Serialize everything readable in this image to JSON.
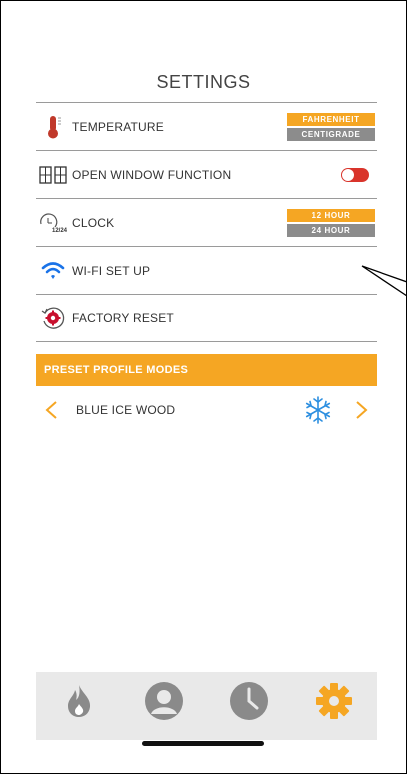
{
  "title": "SETTINGS",
  "settings": {
    "temperature": {
      "label": "TEMPERATURE",
      "options": [
        "FAHRENHEIT",
        "CENTIGRADE"
      ],
      "selected": "FAHRENHEIT"
    },
    "open_window": {
      "label": "OPEN WINDOW FUNCTION",
      "enabled": true
    },
    "clock": {
      "label": "CLOCK",
      "icon_text": "12/24",
      "options": [
        "12 HOUR",
        "24 HOUR"
      ],
      "selected": "12 HOUR"
    },
    "wifi": {
      "label": "WI-FI SET UP"
    },
    "factory_reset": {
      "label": "FACTORY RESET"
    }
  },
  "preset": {
    "header": "PRESET PROFILE MODES",
    "current": "BLUE ICE WOOD",
    "icon": "snowflake-icon"
  },
  "tabbar": {
    "tabs": [
      {
        "icon": "flame-icon",
        "active": false
      },
      {
        "icon": "profile-icon",
        "active": false
      },
      {
        "icon": "clock-icon",
        "active": false
      },
      {
        "icon": "settings-gear-icon",
        "active": true
      }
    ]
  },
  "colors": {
    "accent": "#f5a623",
    "inactive": "#8c8c8c",
    "toggle_on": "#d9342b",
    "wifi": "#1a73e8",
    "snowflake": "#2d8fe0",
    "thermometer": "#c0392b",
    "tab_inactive": "#8a8a8a",
    "tabbar_bg": "#e9e9e9"
  }
}
